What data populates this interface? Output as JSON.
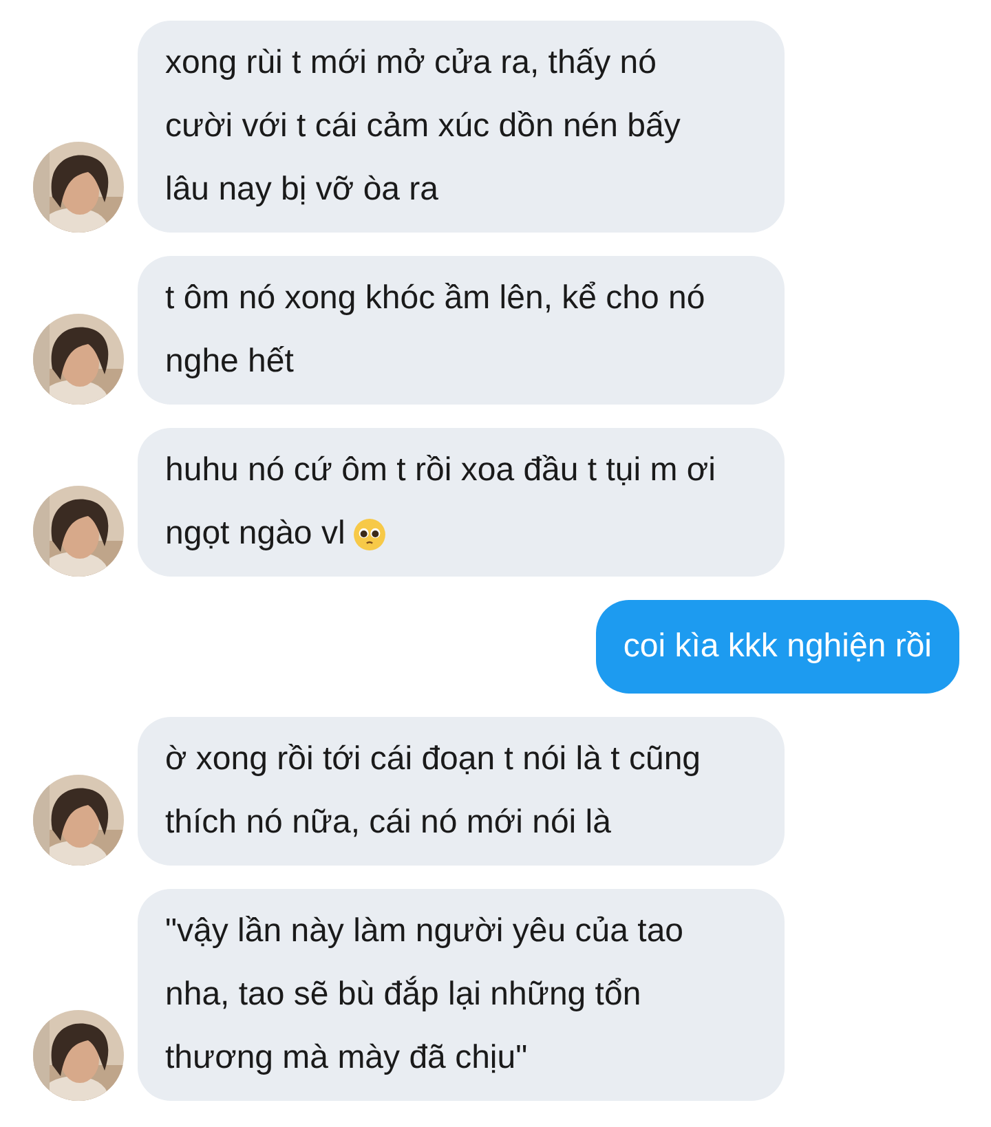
{
  "messages": [
    {
      "kind": "incoming",
      "lines": [
        "xong rùi t mới mở cửa ra, thấy nó",
        "cười với t cái cảm xúc dồn nén bấy",
        "lâu nay bị vỡ òa ra"
      ]
    },
    {
      "kind": "incoming",
      "lines": [
        "t ôm nó xong khóc ầm lên, kể cho nó",
        "nghe hết"
      ]
    },
    {
      "kind": "incoming",
      "lines": [
        "huhu nó cứ ôm t rồi xoa đầu t tụi m ơi",
        "ngọt ngào vl"
      ],
      "emoji": true
    },
    {
      "kind": "outgoing",
      "lines": [
        "coi kìa kkk nghiện rồi"
      ]
    },
    {
      "kind": "incoming",
      "lines": [
        "ờ xong rồi tới cái đoạn t nói là t cũng",
        "thích nó nữa, cái nó mới nói là"
      ]
    },
    {
      "kind": "incoming",
      "lines": [
        "\"vậy lần này làm người yêu của tao",
        "nha, tao sẽ bù đắp lại những tổn",
        "thương mà mày đã chịu\""
      ]
    }
  ]
}
